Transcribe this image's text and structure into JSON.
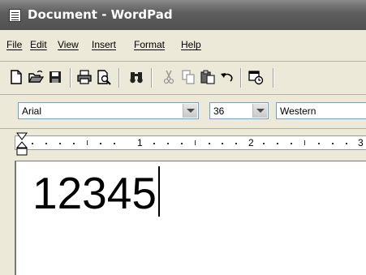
{
  "window": {
    "title": "Document - WordPad"
  },
  "menu": {
    "items": [
      "File",
      "Edit",
      "View",
      "Insert",
      "Format",
      "Help"
    ]
  },
  "toolbar": {
    "buttons": [
      "new-document-icon",
      "open-folder-icon",
      "save-disk-icon",
      "print-icon",
      "print-preview-icon",
      "find-binoculars-icon",
      "cut-scissors-icon",
      "copy-icon",
      "paste-icon",
      "undo-icon",
      "date-time-icon"
    ]
  },
  "format": {
    "font": "Arial",
    "size": "36",
    "script": "Western"
  },
  "ruler": {
    "numbers": [
      "1",
      "2",
      "3"
    ]
  },
  "document": {
    "text": "12345"
  }
}
